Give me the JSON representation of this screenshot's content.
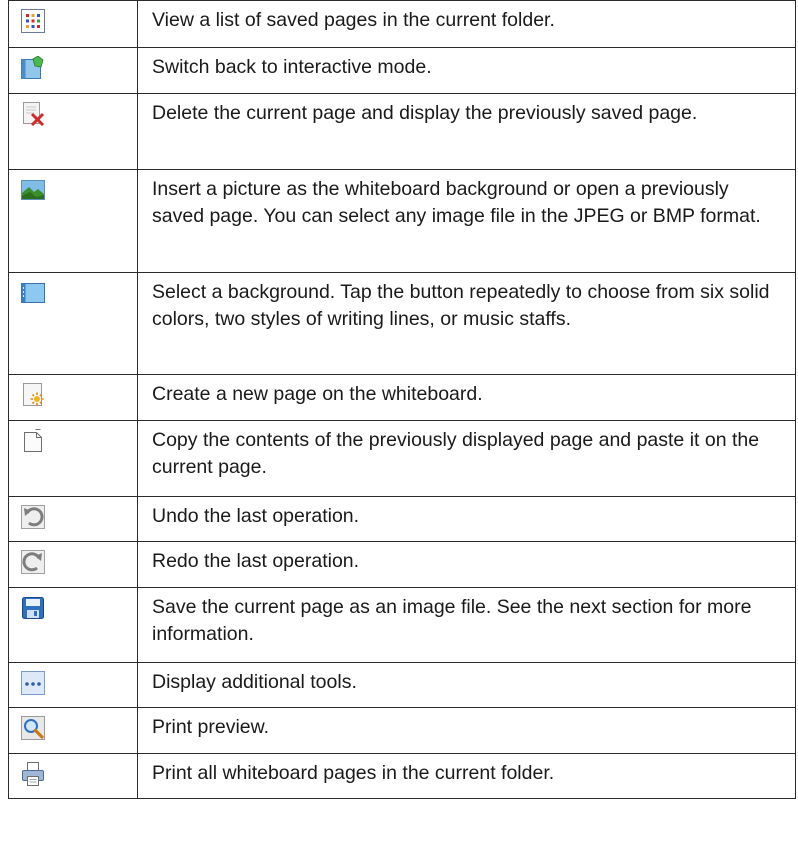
{
  "rows": [
    {
      "icon": "page-list-icon",
      "h": 47,
      "text": "View a list of saved pages in the current folder."
    },
    {
      "icon": "interactive-mode-icon",
      "h": 46,
      "text": "Switch back to interactive mode."
    },
    {
      "icon": "delete-page-icon",
      "h": 76,
      "text": "Delete the current page and display the previously saved page."
    },
    {
      "icon": "insert-picture-icon",
      "h": 103,
      "text": "Insert a picture as the whiteboard background or open a previously saved page. You can select any image file in the JPEG or BMP format."
    },
    {
      "icon": "background-icon",
      "h": 102,
      "text": "Select a background. Tap the button repeatedly to choose from six solid colors, two styles of writing lines, or music staffs."
    },
    {
      "icon": "new-page-icon",
      "h": 46,
      "text": "Create a new page on the whiteboard."
    },
    {
      "icon": "copy-page-icon",
      "h": 76,
      "text": "Copy the contents of the previously displayed page and paste it on the current page."
    },
    {
      "icon": "undo-icon",
      "h": 45,
      "text": "Undo the last operation."
    },
    {
      "icon": "redo-icon",
      "h": 46,
      "text": "Redo the last operation."
    },
    {
      "icon": "save-icon",
      "h": 75,
      "text": "Save the current page as an image file. See the next section for more information."
    },
    {
      "icon": "more-tools-icon",
      "h": 45,
      "text": "Display additional tools."
    },
    {
      "icon": "print-preview-icon",
      "h": 46,
      "text": "Print preview."
    },
    {
      "icon": "print-icon",
      "h": 45,
      "text": "Print all whiteboard pages in the current folder."
    }
  ]
}
